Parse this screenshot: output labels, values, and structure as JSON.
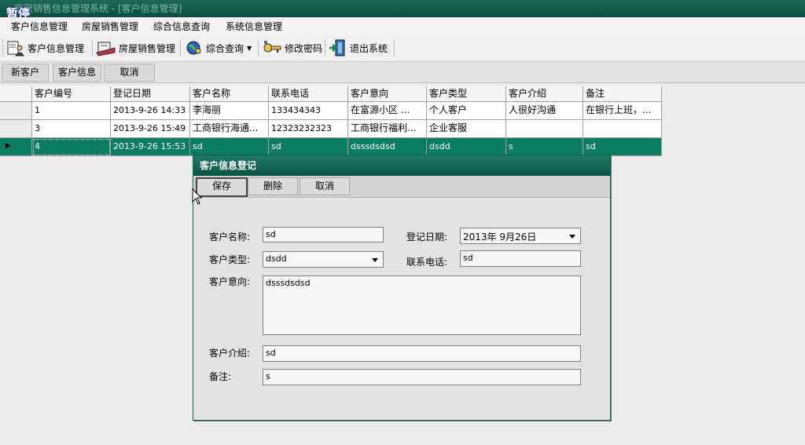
{
  "window": {
    "title": "房屋销售信息管理系统 - [客户信息管理]",
    "overlay_label": "暂停"
  },
  "menu": [
    "客户信息管理",
    "房屋销售管理",
    "综合信息查询",
    "系统信息管理"
  ],
  "toolbar": {
    "customer": "客户信息管理",
    "sales": "房屋销售管理",
    "query": "综合查询",
    "password": "修改密码",
    "exit": "退出系统"
  },
  "subtoolbar": {
    "new": "新客户",
    "info": "客户信息",
    "cancel": "取消"
  },
  "grid": {
    "columns": [
      "客户编号",
      "登记日期",
      "客户名称",
      "联系电话",
      "客户意向",
      "客户类型",
      "客户介绍",
      "备注"
    ],
    "rows": [
      [
        "1",
        "2013-9-26 14:33",
        "李海丽",
        "133434343",
        "在富源小区 ...",
        "个人客户",
        "人很好沟通",
        "在银行上班，..."
      ],
      [
        "3",
        "2013-9-26 15:49",
        "工商银行海通...",
        "12323232323",
        "工商银行福利...",
        "企业客服",
        "",
        ""
      ],
      [
        "4",
        "2013-9-26 15:53",
        "sd",
        "sd",
        "dsssdsdsd",
        "dsdd",
        "s",
        "sd"
      ]
    ]
  },
  "dialog": {
    "title": "客户信息登记",
    "buttons": {
      "save": "保存",
      "delete": "删除",
      "cancel": "取消"
    },
    "labels": {
      "name": "客户名称:",
      "date": "登记日期:",
      "type": "客户类型:",
      "phone": "联系电话:",
      "intent": "客户意向:",
      "intro": "客户介绍:",
      "remark": "备注:"
    },
    "values": {
      "name": "sd",
      "date": "2013年 9月26日",
      "type": "dsdd",
      "phone": "sd",
      "intent": "dsssdsdsd",
      "intro": "sd",
      "remark": "s"
    }
  }
}
